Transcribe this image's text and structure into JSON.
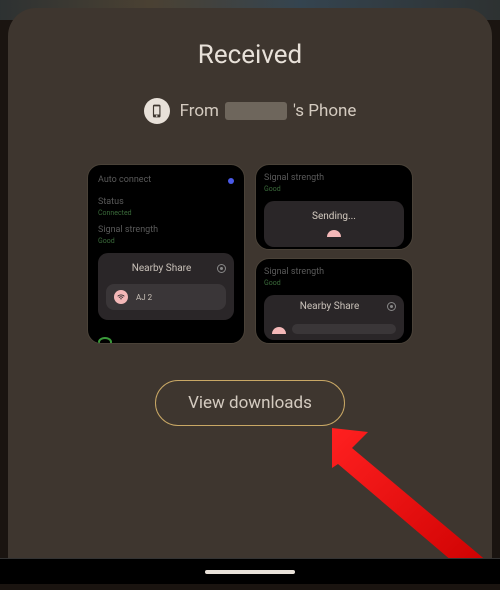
{
  "title": "Received",
  "from": {
    "prefix": "From",
    "suffix": "'s Phone"
  },
  "previews": {
    "left": {
      "auto_connect": "Auto connect",
      "status_label": "Status",
      "status_value": "Connected",
      "signal_label": "Signal strength",
      "signal_value": "Good",
      "nearby_share": "Nearby Share",
      "device_name": "AJ 2"
    },
    "right_top": {
      "signal_label": "Signal strength",
      "signal_value": "Good",
      "sending": "Sending..."
    },
    "right_bottom": {
      "signal_label": "Signal strength",
      "signal_value": "Good",
      "nearby_share": "Nearby Share"
    }
  },
  "view_downloads": "View downloads"
}
